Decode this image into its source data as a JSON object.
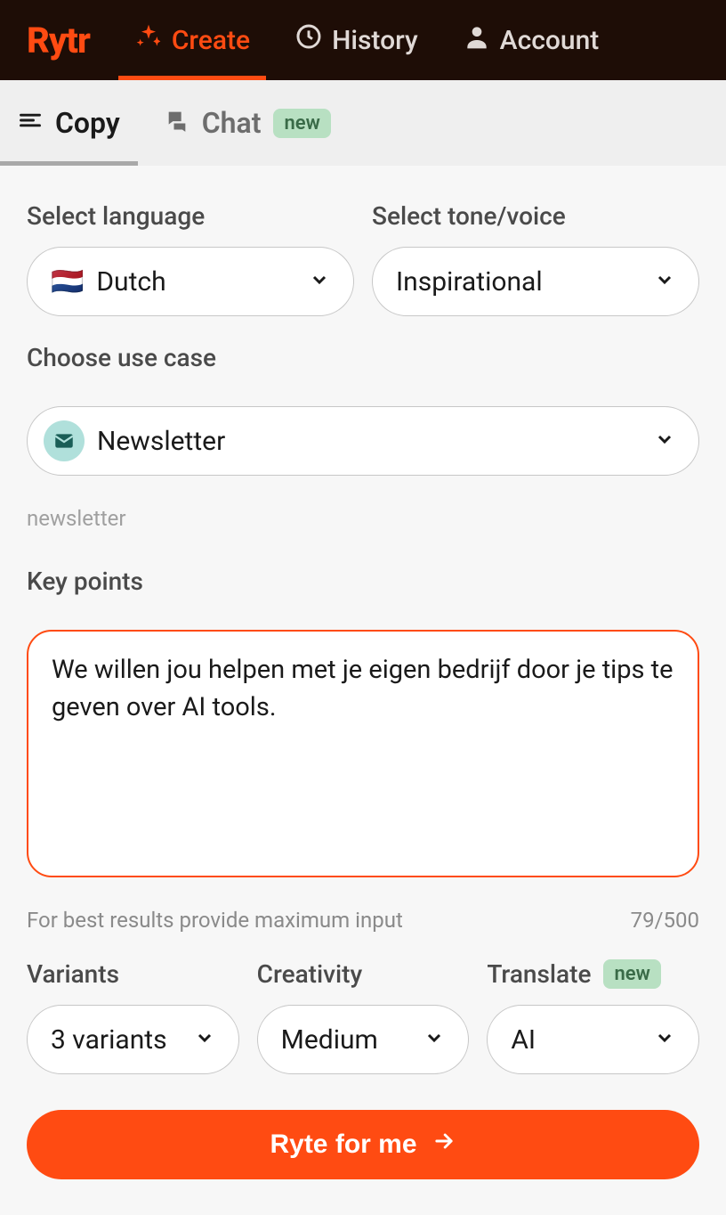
{
  "header": {
    "logo": "Rytr",
    "nav": [
      {
        "label": "Create",
        "active": true
      },
      {
        "label": "History",
        "active": false
      },
      {
        "label": "Account",
        "active": false
      }
    ]
  },
  "subtabs": {
    "copy": "Copy",
    "chat": "Chat",
    "new_badge": "new"
  },
  "form": {
    "language": {
      "label": "Select language",
      "value": "Dutch",
      "flag": "🇳🇱"
    },
    "tone": {
      "label": "Select tone/voice",
      "value": "Inspirational"
    },
    "usecase": {
      "label": "Choose use case",
      "value": "Newsletter",
      "hint": "newsletter"
    },
    "keypoints": {
      "label": "Key points",
      "value": "We willen jou helpen met je eigen bedrijf door je tips te geven over AI tools.",
      "hint": "For best results provide maximum input",
      "counter": "79/500"
    },
    "variants": {
      "label": "Variants",
      "value": "3 variants"
    },
    "creativity": {
      "label": "Creativity",
      "value": "Medium"
    },
    "translate": {
      "label": "Translate",
      "new_badge": "new",
      "value": "AI"
    },
    "cta": "Ryte for me"
  }
}
